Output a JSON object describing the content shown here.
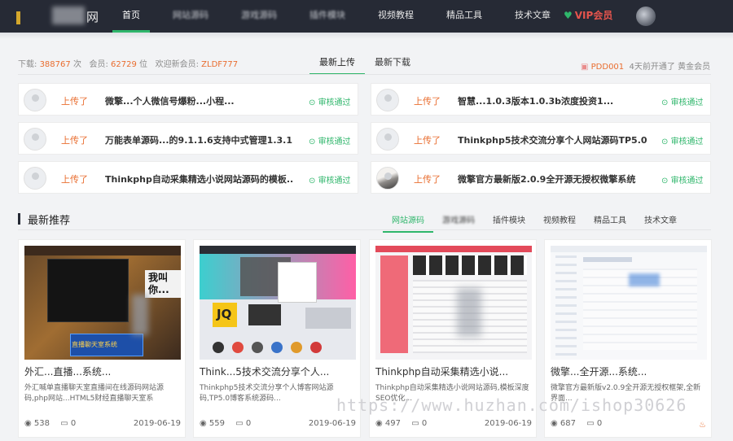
{
  "nav": {
    "logo_text": "网",
    "items": [
      "首页",
      "网站源码",
      "游戏源码",
      "插件模块",
      "视频教程",
      "精品工具",
      "技术文章"
    ],
    "vip_label": "VIP会员"
  },
  "stats": {
    "downloads_label": "下载:",
    "downloads": "388767",
    "downloads_unit": "次",
    "members_label": "会员:",
    "members": "62729",
    "members_unit": "位",
    "welcome_label": "欢迎新会员:",
    "new_member": "ZLDF777"
  },
  "seg_tabs": [
    "最新上传",
    "最新下载"
  ],
  "notice": {
    "user": "PDD001",
    "text": "4天前开通了 黄金会员"
  },
  "uploads": [
    {
      "action": "上传了",
      "title": "微擎...个人微信号爆粉...小程...",
      "status": "审核通过"
    },
    {
      "action": "上传了",
      "title": "智慧...1.0.3版本1.0.3b浓度投资1...",
      "status": "审核通过"
    },
    {
      "action": "上传了",
      "title": "万能表单源码...的9.1.1.6支持中式管理1.3.1",
      "status": "审核通过"
    },
    {
      "action": "上传了",
      "title": "Thinkphp5技术交流分享个人网站源码TP5.0...",
      "status": "审核通过"
    },
    {
      "action": "上传了",
      "title": "Thinkphp自动采集精选小说网站源码的模板...",
      "status": "审核通过"
    },
    {
      "action": "上传了",
      "title": "微擎官方最新版2.0.9全开源无授权微擎系统",
      "status": "审核通过"
    }
  ],
  "section": {
    "title": "最新推荐",
    "tabs": [
      "网站源码",
      "游戏源码",
      "插件模块",
      "视频教程",
      "精品工具",
      "技术文章"
    ]
  },
  "products": [
    {
      "title": "外汇...直播...系统...",
      "desc": "外汇喊单直播聊天室直播间在线源码网站源码,php网站...HTML5财经直播聊天室系",
      "views": "538",
      "comments": "0",
      "date": "2019-06-19",
      "thumb_text": "我叫你...",
      "thumb_caption": "直播聊天室系统"
    },
    {
      "title": "Think...5技术交流分享个人...",
      "desc": "Thinkphp5技术交流分享个人博客网站源码,TP5.0博客系统源码...",
      "views": "559",
      "comments": "0",
      "date": "2019-06-19",
      "thumb_text": "JQ",
      "thumb_caption": ""
    },
    {
      "title": "Thinkphp自动采集精选小说...",
      "desc": "Thinkphp自动采集精选小说网站源码,模板深度SEO优化...",
      "views": "497",
      "comments": "0",
      "date": "2019-06-19",
      "thumb_text": "",
      "thumb_caption": ""
    },
    {
      "title": "微擎...全开源...系统...",
      "desc": "微擎官方最新版v2.0.9全开源无授权框架,全新界面...",
      "views": "687",
      "comments": "0",
      "date": "",
      "thumb_text": "",
      "thumb_caption": ""
    }
  ],
  "watermark": "https://www.huzhan.com/ishop30626",
  "colors": {
    "accent": "#2fb66b",
    "highlight": "#e96d2f",
    "nav_bg": "#262a35"
  }
}
